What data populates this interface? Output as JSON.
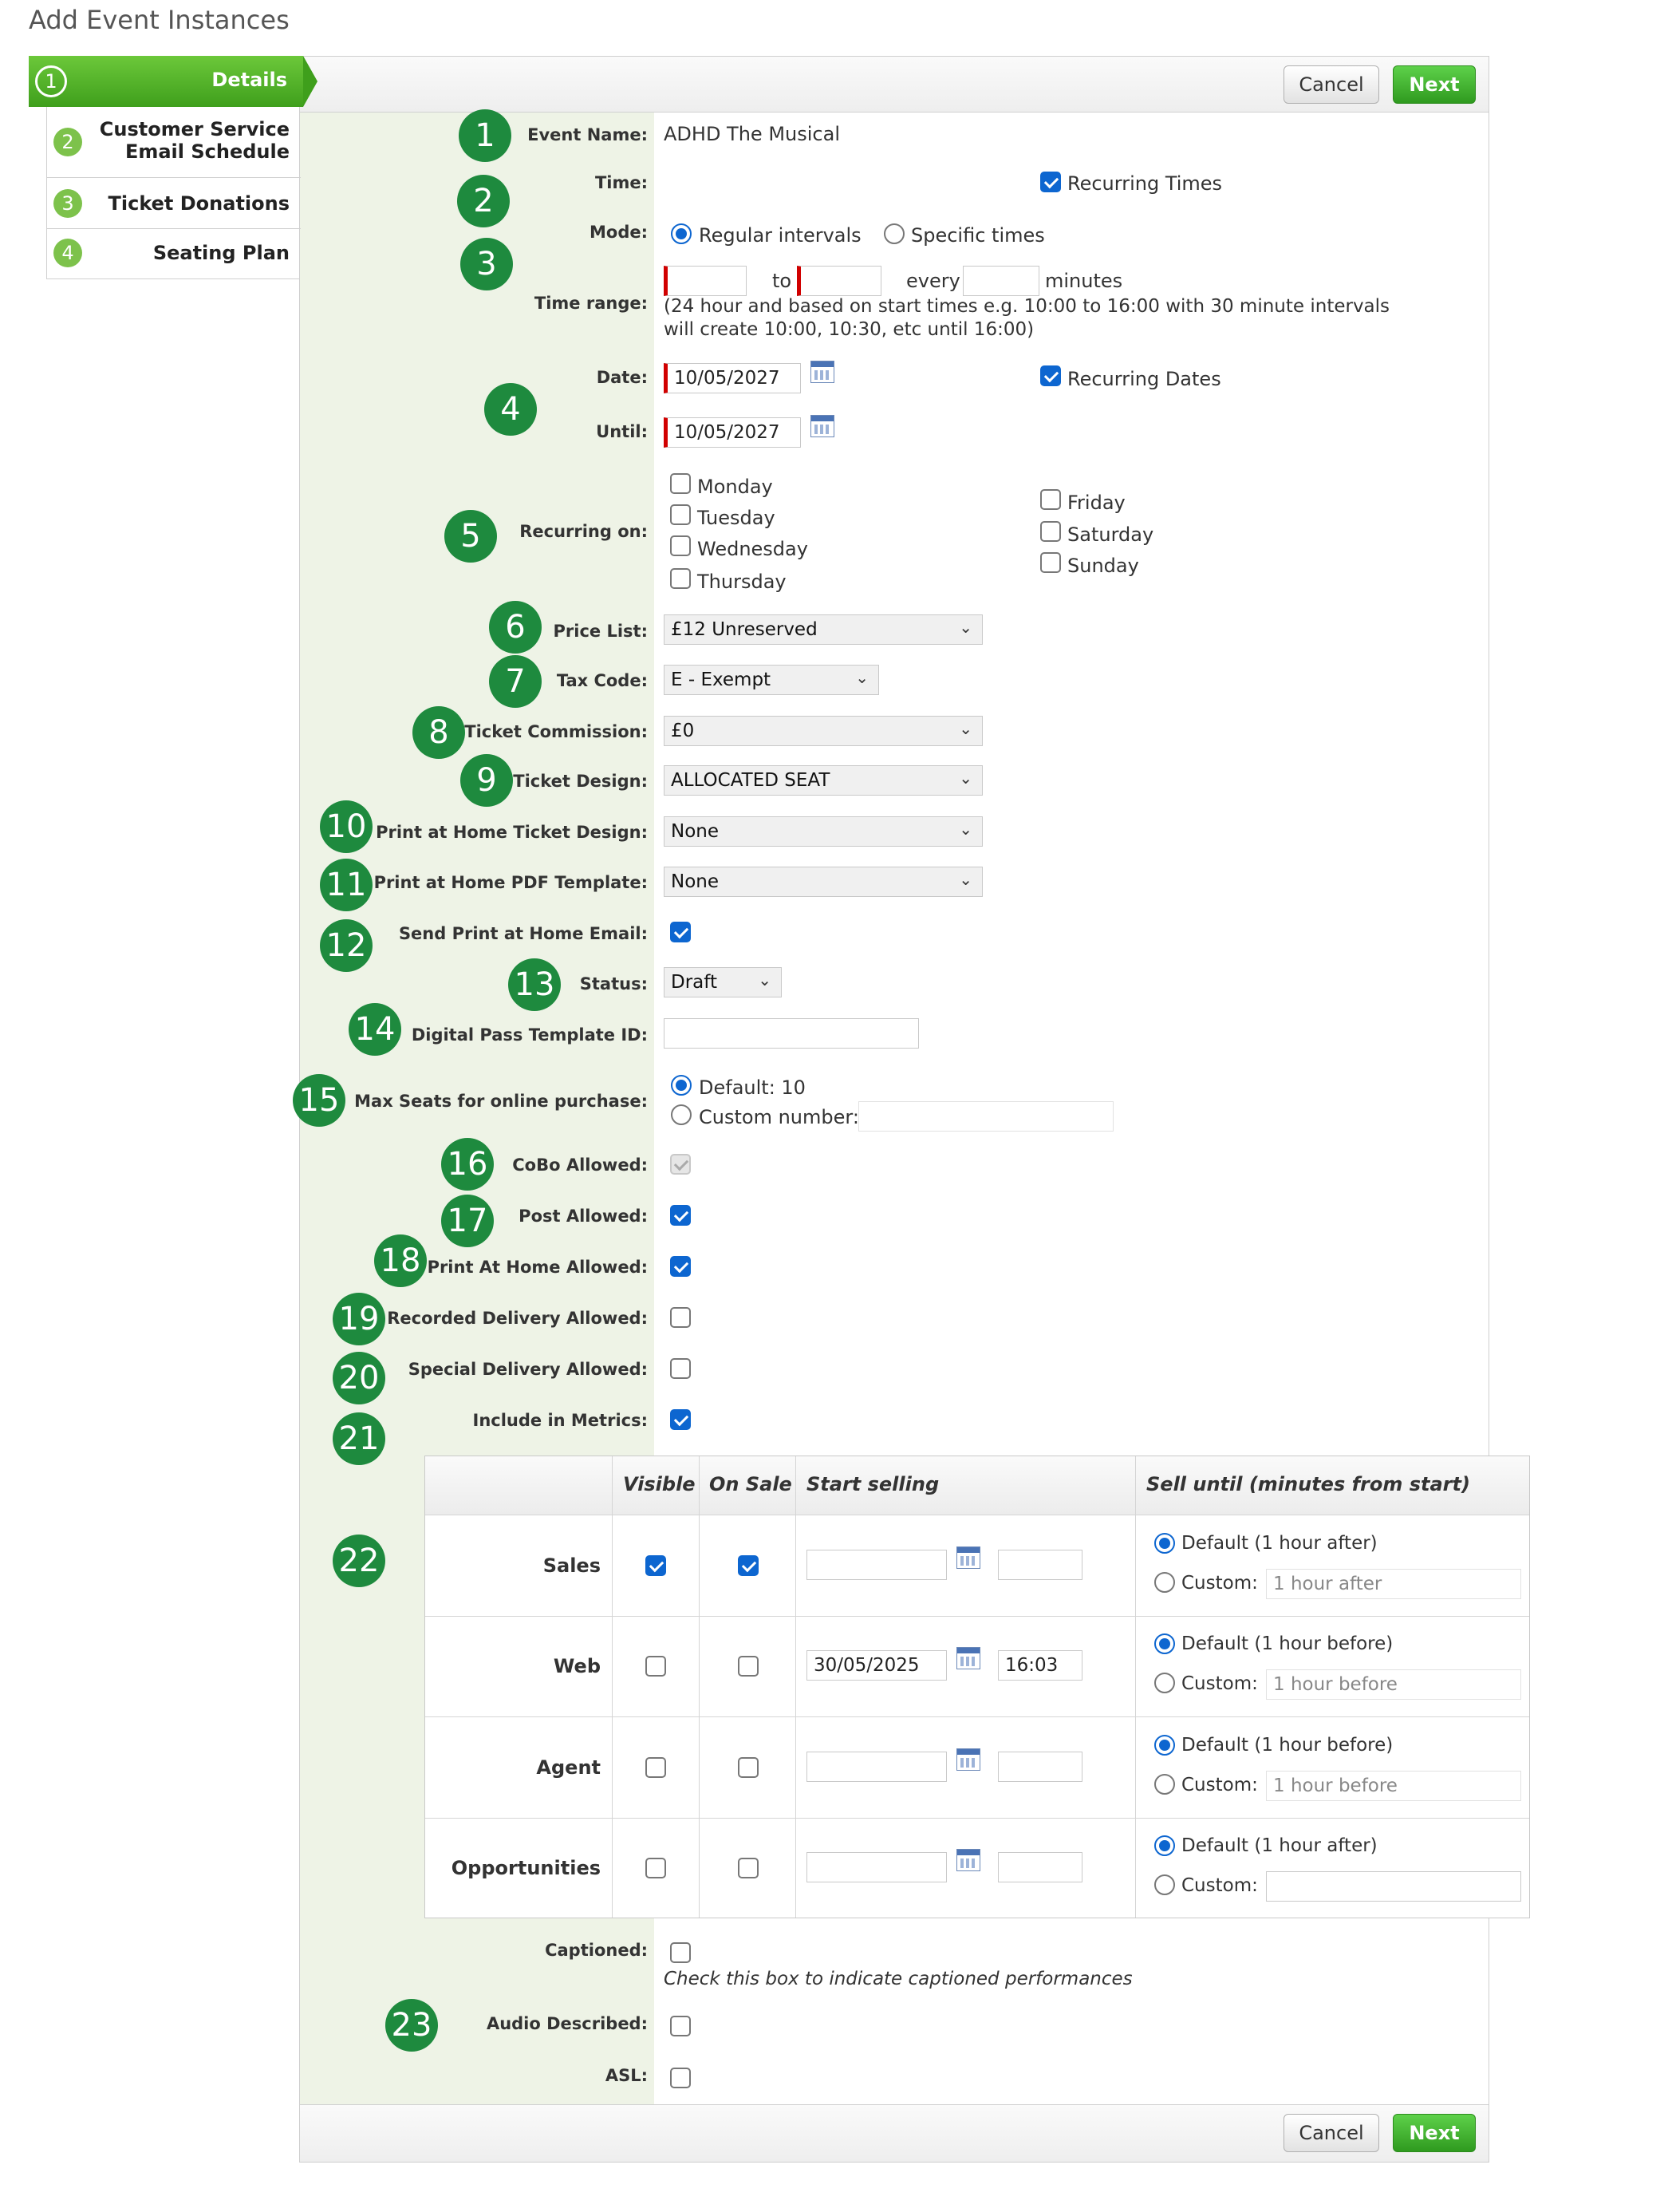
{
  "page": {
    "title": "Add Event Instances"
  },
  "wizard": {
    "steps": [
      {
        "num": "1",
        "label": "Details",
        "active": true
      },
      {
        "num": "2",
        "label_line1": "Customer Service",
        "label_line2": "Email Schedule"
      },
      {
        "num": "3",
        "label": "Ticket Donations"
      },
      {
        "num": "4",
        "label": "Seating Plan"
      }
    ]
  },
  "toolbar": {
    "cancel_label": "Cancel",
    "next_label": "Next"
  },
  "callouts": [
    "1",
    "2",
    "3",
    "4",
    "5",
    "6",
    "7",
    "8",
    "9",
    "10",
    "11",
    "12",
    "13",
    "14",
    "15",
    "16",
    "17",
    "18",
    "19",
    "20",
    "21",
    "22",
    "23"
  ],
  "form": {
    "event_name": {
      "label": "Event Name:",
      "value": "ADHD The Musical"
    },
    "time": {
      "label": "Time:",
      "recurring_times_label": "Recurring Times",
      "recurring_times_checked": true
    },
    "mode": {
      "label": "Mode:",
      "regular_label": "Regular intervals",
      "specific_label": "Specific times",
      "selected": "regular"
    },
    "time_range": {
      "label": "Time range:",
      "to_label": "to",
      "every_label": "every",
      "minutes_label": "minutes",
      "help_line1": "(24 hour and based on start times e.g. 10:00 to 16:00 with 30 minute intervals",
      "help_line2": "will create 10:00, 10:30, etc until 16:00)"
    },
    "date": {
      "label": "Date:",
      "value": "10/05/2027",
      "recurring_dates_label": "Recurring Dates",
      "recurring_dates_checked": true
    },
    "until": {
      "label": "Until:",
      "value": "10/05/2027"
    },
    "recurring_on": {
      "label": "Recurring on:",
      "days_left": [
        "Monday",
        "Tuesday",
        "Wednesday",
        "Thursday"
      ],
      "days_right": [
        "Friday",
        "Saturday",
        "Sunday"
      ]
    },
    "price_list": {
      "label": "Price List:",
      "value": "£12 Unreserved"
    },
    "tax_code": {
      "label": "Tax Code:",
      "value": "E - Exempt"
    },
    "ticket_commission": {
      "label": "Ticket Commission:",
      "value": "£0"
    },
    "ticket_design": {
      "label": "Ticket Design:",
      "value": "ALLOCATED SEAT"
    },
    "print_home_ticket_design": {
      "label": "Print at Home Ticket Design:",
      "value": "None"
    },
    "print_home_pdf_template": {
      "label": "Print at Home PDF Template:",
      "value": "None"
    },
    "send_print_home_email": {
      "label": "Send Print at Home Email:",
      "checked": true
    },
    "status": {
      "label": "Status:",
      "value": "Draft"
    },
    "digital_pass_template_id": {
      "label": "Digital Pass Template ID:",
      "value": ""
    },
    "max_seats": {
      "label": "Max Seats for online purchase:",
      "default_label": "Default: 10",
      "custom_label": "Custom number:",
      "selected": "default"
    },
    "cobo_allowed": {
      "label": "CoBo Allowed:",
      "checked": true,
      "disabled": true
    },
    "post_allowed": {
      "label": "Post Allowed:",
      "checked": true
    },
    "print_at_home_allowed": {
      "label": "Print At Home Allowed:",
      "checked": true
    },
    "recorded_delivery_allowed": {
      "label": "Recorded Delivery Allowed:",
      "checked": false
    },
    "special_delivery_allowed": {
      "label": "Special Delivery Allowed:",
      "checked": false
    },
    "include_in_metrics": {
      "label": "Include in Metrics:",
      "checked": true
    },
    "captioned": {
      "label": "Captioned:",
      "checked": false,
      "help": "Check this box to indicate captioned performances"
    },
    "audio_described": {
      "label": "Audio Described:",
      "checked": false
    },
    "asl": {
      "label": "ASL:",
      "checked": false
    }
  },
  "channels_table": {
    "headers": {
      "visible": "Visible",
      "on_sale": "On Sale",
      "start_selling": "Start selling",
      "sell_until": "Sell until (minutes from start)"
    },
    "rows": [
      {
        "name": "Sales",
        "visible": true,
        "on_sale": true,
        "start_date": "",
        "start_time": "",
        "default_label": "Default (1 hour after)",
        "custom_label": "Custom:",
        "custom_placeholder": "1 hour after"
      },
      {
        "name": "Web",
        "visible": false,
        "on_sale": false,
        "start_date": "30/05/2025",
        "start_time": "16:03",
        "default_label": "Default (1 hour before)",
        "custom_label": "Custom:",
        "custom_placeholder": "1 hour before"
      },
      {
        "name": "Agent",
        "visible": false,
        "on_sale": false,
        "start_date": "",
        "start_time": "",
        "default_label": "Default (1 hour before)",
        "custom_label": "Custom:",
        "custom_placeholder": "1 hour before"
      },
      {
        "name": "Opportunities",
        "visible": false,
        "on_sale": false,
        "start_date": "",
        "start_time": "",
        "default_label": "Default (1 hour after)",
        "custom_label": "Custom:",
        "custom_placeholder": ""
      }
    ]
  },
  "colors": {
    "accent_green": "#1e8a3e",
    "wizard_active": "#5cb82e",
    "sidebar_bg": "#eef3e6",
    "checkbox_blue": "#0d66d0",
    "required_red": "#d10000"
  }
}
